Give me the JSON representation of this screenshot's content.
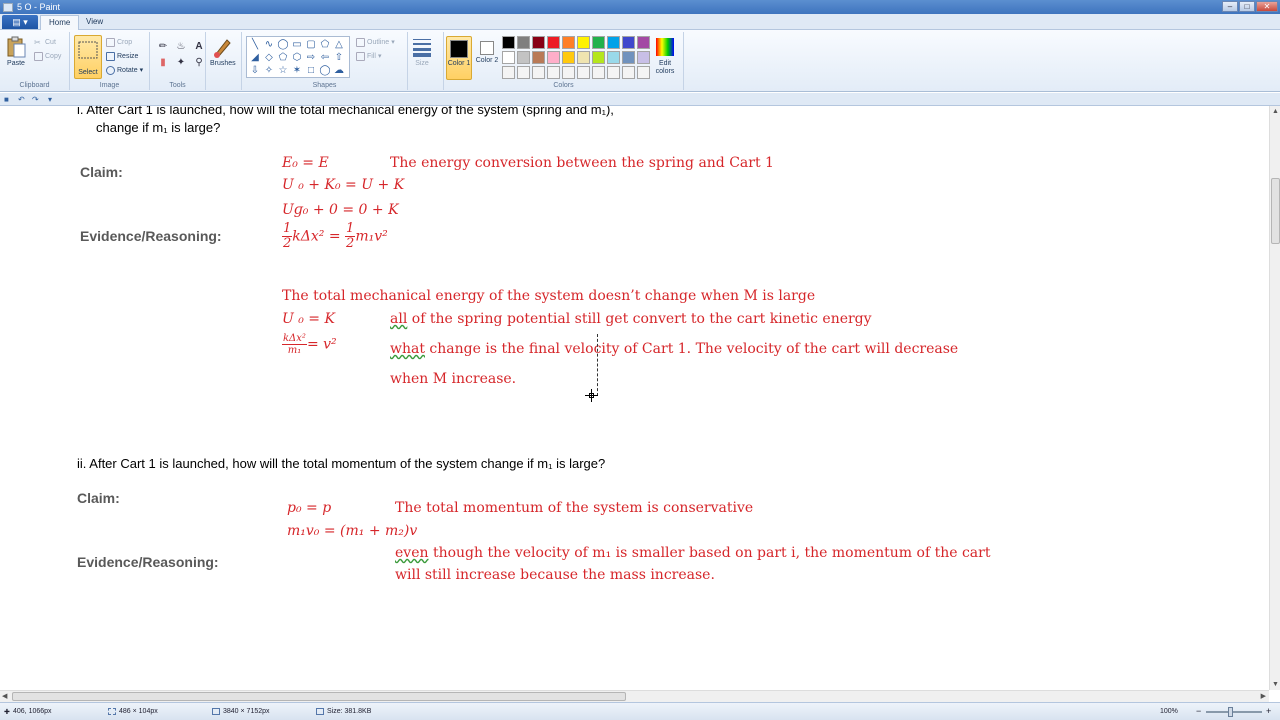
{
  "window": {
    "title": "5 O - Paint"
  },
  "tabs": [
    {
      "label": "Home",
      "active": true
    },
    {
      "label": "View",
      "active": false
    }
  ],
  "ribbon": {
    "clipboard": {
      "label": "Clipboard",
      "paste": "Paste",
      "cut": "Cut",
      "copy": "Copy"
    },
    "image": {
      "label": "Image",
      "select": "Select",
      "crop": "Crop",
      "resize": "Resize",
      "rotate": "Rotate"
    },
    "tools": {
      "label": "Tools"
    },
    "brushes": {
      "label": "Brushes"
    },
    "shapes": {
      "label": "Shapes",
      "outline": "Outline",
      "fill": "Fill"
    },
    "size": {
      "label": "Size"
    },
    "colors": {
      "label": "Colors",
      "color1": "Color 1",
      "color2": "Color 2",
      "edit": "Edit colors",
      "color1_value": "#000000",
      "color2_value": "#ffffff",
      "palette": [
        "#000000",
        "#7f7f7f",
        "#880015",
        "#ed1c24",
        "#ff7f27",
        "#fff200",
        "#22b14c",
        "#00a2e8",
        "#3f48cc",
        "#a349a4",
        "#ffffff",
        "#c3c3c3",
        "#b97a57",
        "#ffaec9",
        "#ffc90e",
        "#efe4b0",
        "#b5e61d",
        "#99d9ea",
        "#7092be",
        "#c8bfe7",
        "#f4f4f4",
        "#f4f4f4",
        "#f4f4f4",
        "#f4f4f4",
        "#f4f4f4",
        "#f4f4f4",
        "#f4f4f4",
        "#f4f4f4",
        "#f4f4f4",
        "#f4f4f4"
      ]
    }
  },
  "doc": {
    "q1": {
      "line1": "i.   After Cart 1 is launched, how will the total mechanical energy of the system (spring and m₁),",
      "line2": "change if m₁ is large?",
      "claim": "Claim:",
      "evidence": "Evidence/Reasoning:",
      "eq1": "E₀ = E",
      "note1": "The energy conversion between the spring and Cart 1",
      "eq2": "U  ₀ + K₀ = U  + K",
      "eq3": "Uɡ₀ + 0 = 0 + K",
      "eq4_rhs": "= ",
      "eq4_tail": "m₁v²",
      "para1": "The total mechanical energy of the system doesn’t change when M is large",
      "eq5": "U  ₀ = K",
      "note2_u": "all",
      "note2": " of the spring potential still get convert to the cart kinetic energy",
      "eq6_tail": "= v²",
      "note3_u": "what",
      "note3": " change is the final velocity of Cart 1. The velocity of the cart will decrease",
      "note4": "when M increase."
    },
    "q2": {
      "line1": "ii.  After Cart 1 is launched, how will the total momentum of the system change if m₁ is large?",
      "claim": "Claim:",
      "evidence": "Evidence/Reasoning:",
      "eq1": "p₀ = p",
      "note1": "The total momentum of the system is conservative",
      "eq2": "m₁v₀ = (m₁ + m₂)v",
      "note2_u": "even",
      "note2": " though the velocity of m₁ is smaller based on part i, the momentum of the cart",
      "note3": "will still increase because the mass increase."
    }
  },
  "status": {
    "cursor": "406, 1066px",
    "selection": "486 × 104px",
    "image_size": "3840 × 7152px",
    "file_size": "Size: 381.8KB",
    "zoom": "100%"
  }
}
